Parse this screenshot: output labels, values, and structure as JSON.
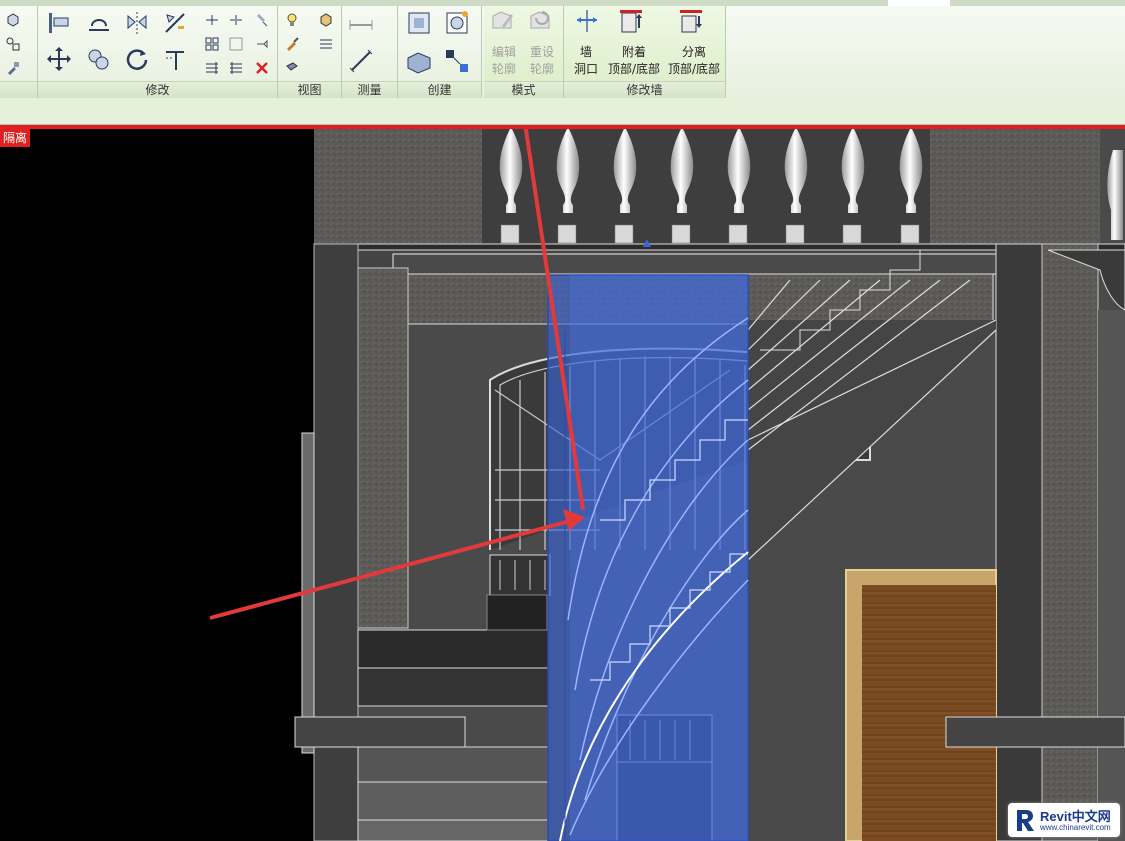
{
  "ribbon": {
    "panels": {
      "modify": "修改",
      "view": "视图",
      "measure": "测量",
      "create": "创建",
      "mode": "模式",
      "modify_wall": "修改墙"
    },
    "buttons": {
      "edit_profile": "编辑\n轮廓",
      "reset_profile": "重设\n轮廓",
      "wall_opening": "墙\n洞口",
      "attach_top_base": "附着\n顶部/底部",
      "detach_top_base": "分离\n顶部/底部"
    }
  },
  "viewport": {
    "isolate_tag": "隔离"
  },
  "watermark": {
    "title": "Revit中文网",
    "url": "www.chinarevit.com"
  },
  "colors": {
    "ribbon_bg": "#e7f0df",
    "isolate_red": "#e02020",
    "selection_blue": "#3a64d8",
    "annotation_arrow": "#e23a3a"
  }
}
